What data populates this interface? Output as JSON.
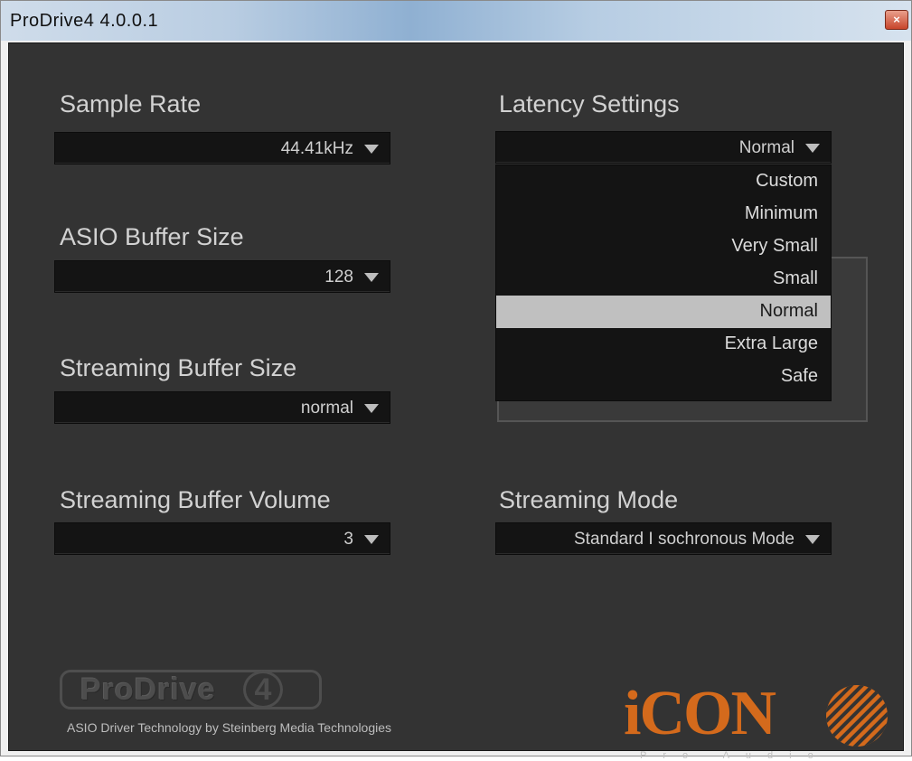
{
  "window": {
    "title": "ProDrive4 4.0.0.1",
    "close_symbol": "×"
  },
  "sample_rate": {
    "label": "Sample Rate",
    "value": "44.41kHz"
  },
  "asio_buffer": {
    "label": "ASIO Buffer Size",
    "value": "128"
  },
  "streaming_buffer_size": {
    "label": "Streaming Buffer Size",
    "value": "normal"
  },
  "streaming_buffer_volume": {
    "label": "Streaming Buffer Volume",
    "value": "3"
  },
  "latency": {
    "label": "Latency Settings",
    "value": "Normal",
    "options": [
      "Custom",
      "Minimum",
      "Very Small",
      "Small",
      "Normal",
      "Extra Large",
      "Safe"
    ],
    "selected": "Normal"
  },
  "streaming_mode": {
    "label": "Streaming Mode",
    "value": "Standard I sochronous Mode"
  },
  "branding": {
    "product_logo": "ProDrive",
    "product_number": "4",
    "credit": "ASIO Driver Technology by Steinberg Media Technologies",
    "company_logo": "iCON",
    "company_sub": "Pro Audio",
    "accent_color": "#d46a1c"
  },
  "colors": {
    "panel_bg": "#333333",
    "dropdown_bg": "#141414",
    "selected_item": "#c0c0c0",
    "title_bar": "#b9cde2"
  }
}
